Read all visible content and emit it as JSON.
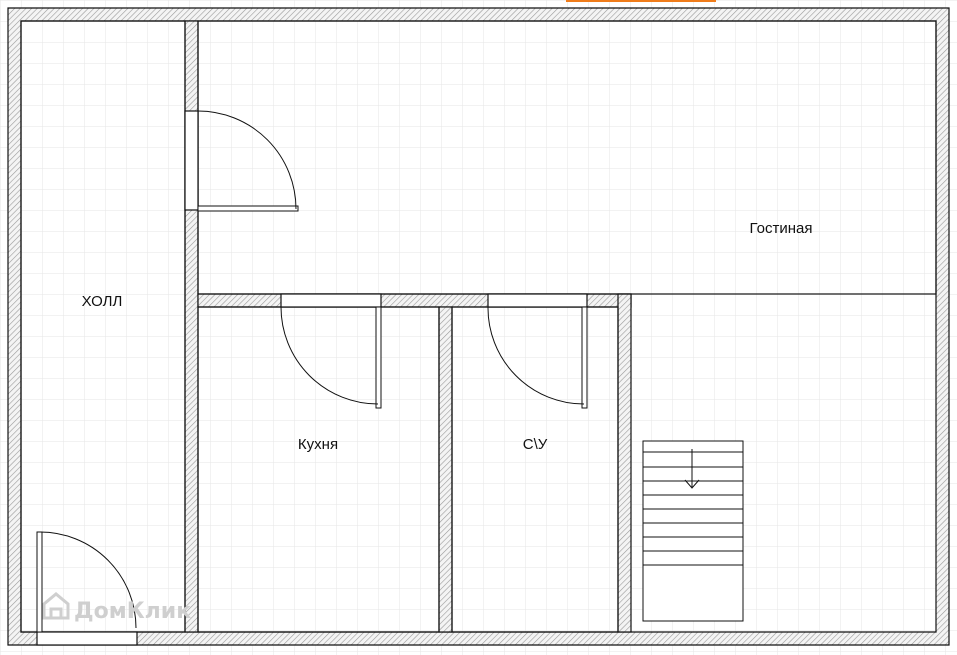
{
  "rooms": {
    "hall": "ХОЛЛ",
    "living": "Гостиная",
    "kitchen": "Кухня",
    "bathroom": "С\\У"
  },
  "watermark": {
    "text": "ДомКлик",
    "icon": "house-logo-icon"
  },
  "stairs": {
    "direction": "down",
    "icon": "arrow-down-icon"
  },
  "colors": {
    "wall_fill": "#ffffff",
    "wall_hatch": "#9a9a9a",
    "line": "#111111",
    "grid": "#e6e6e6",
    "top_accent": "#f07c1a",
    "watermark": "#cfcfcf"
  }
}
